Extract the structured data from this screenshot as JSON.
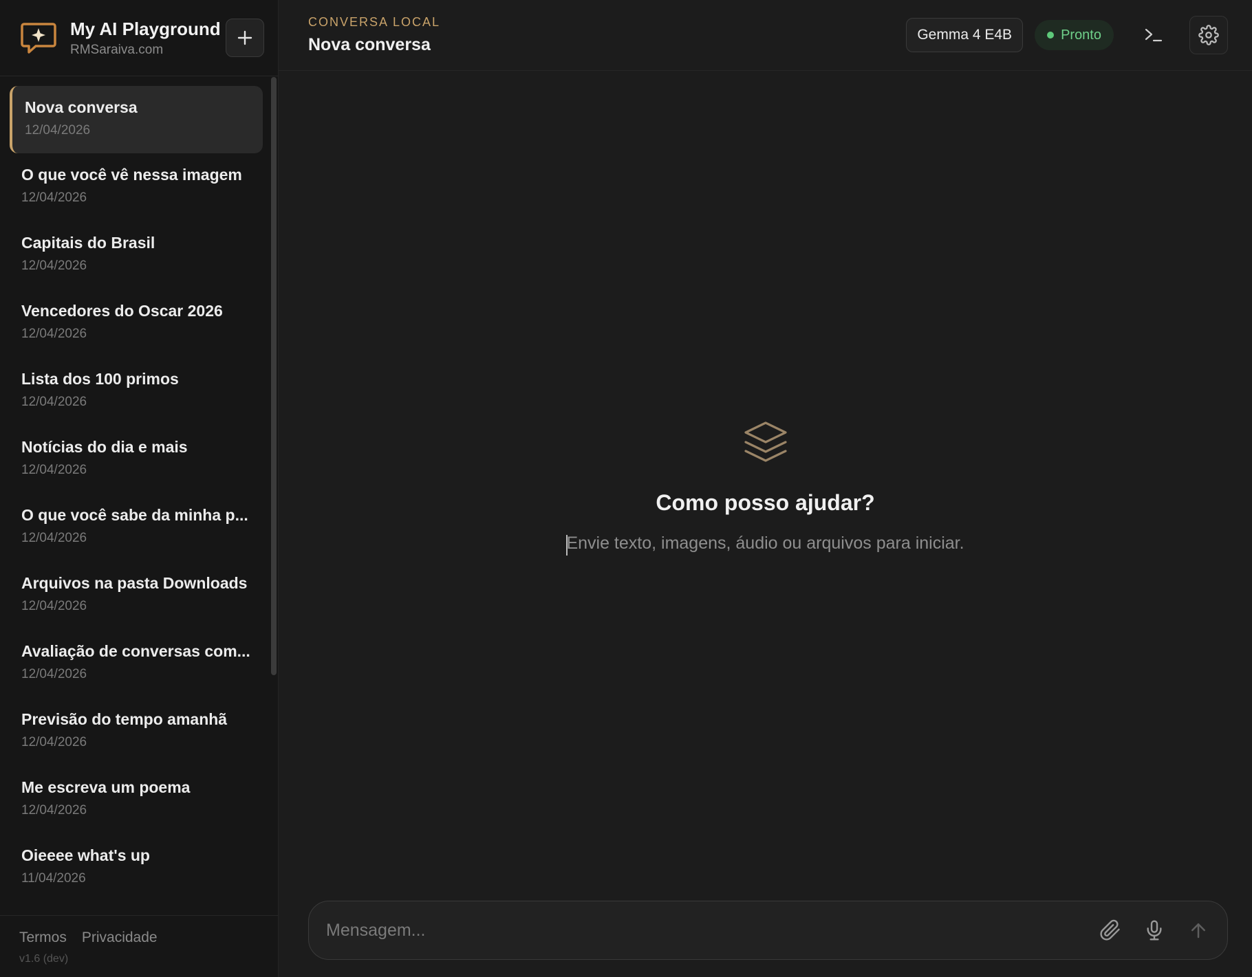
{
  "app": {
    "brand_title": "My AI Playground",
    "brand_sub": "RMSaraiva.com",
    "accent_color": "#c9a36a"
  },
  "sidebar": {
    "new_chat_icon": "plus-icon",
    "conversations": [
      {
        "title": "Nova conversa",
        "date": "12/04/2026",
        "active": true
      },
      {
        "title": "O que você vê nessa imagem",
        "date": "12/04/2026"
      },
      {
        "title": "Capitais do Brasil",
        "date": "12/04/2026"
      },
      {
        "title": "Vencedores do Oscar 2026",
        "date": "12/04/2026"
      },
      {
        "title": "Lista dos 100 primos",
        "date": "12/04/2026"
      },
      {
        "title": "Notícias do dia e mais",
        "date": "12/04/2026"
      },
      {
        "title": "O que você sabe da minha p...",
        "date": "12/04/2026"
      },
      {
        "title": "Arquivos na pasta Downloads",
        "date": "12/04/2026"
      },
      {
        "title": "Avaliação de conversas com...",
        "date": "12/04/2026"
      },
      {
        "title": "Previsão do tempo amanhã",
        "date": "12/04/2026"
      },
      {
        "title": "Me escreva um poema",
        "date": "12/04/2026"
      },
      {
        "title": "Oieeee what's up",
        "date": "11/04/2026"
      }
    ],
    "footer": {
      "terms": "Termos",
      "privacy": "Privacidade",
      "version": "v1.6 (dev)"
    }
  },
  "header": {
    "eyebrow": "CONVERSA LOCAL",
    "title": "Nova conversa",
    "model": "Gemma 4 E4B",
    "status": "Pronto",
    "status_color": "#6fd08a"
  },
  "welcome": {
    "icon": "layers-icon",
    "title": "Como posso ajudar?",
    "subtitle": "Envie texto, imagens, áudio ou arquivos para iniciar."
  },
  "composer": {
    "placeholder": "Mensagem..."
  }
}
